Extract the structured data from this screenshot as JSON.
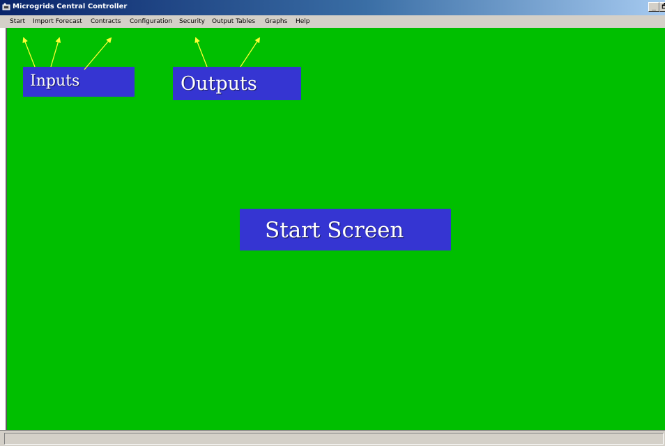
{
  "window": {
    "title": "Microgrids Central Controller",
    "controls": {
      "minimize_glyph": "_",
      "restore_glyph": "🗗"
    }
  },
  "menubar": {
    "items": [
      {
        "label": "Start"
      },
      {
        "label": "Import Forecast"
      },
      {
        "label": "Contracts"
      },
      {
        "label": "Configuration"
      },
      {
        "label": "Security"
      },
      {
        "label": "Output Tables"
      },
      {
        "label": "Graphs"
      },
      {
        "label": "Help"
      }
    ]
  },
  "annotations": {
    "inputs_label": "Inputs",
    "outputs_label": "Outputs",
    "start_screen_label": "Start Screen"
  },
  "colors": {
    "workspace": "#00bf00",
    "label_box": "#3535d2",
    "arrow": "#ffff33",
    "menubar": "#d4d0c8",
    "titlebar_start": "#0a246a"
  }
}
